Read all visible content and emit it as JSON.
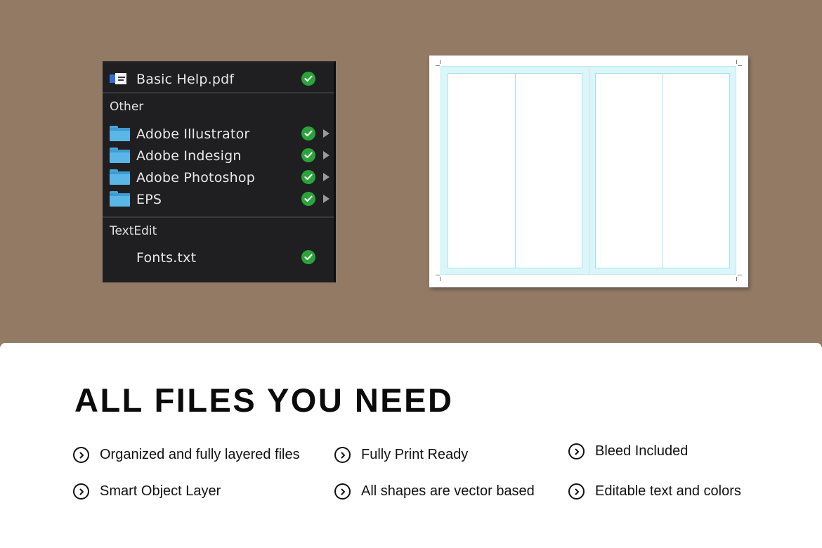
{
  "finder": {
    "top_file": {
      "name": "Basic Help.pdf",
      "icon": "pdf-icon"
    },
    "sections": [
      {
        "label": "Other",
        "items": [
          {
            "name": "Adobe Illustrator",
            "icon": "folder-icon"
          },
          {
            "name": "Adobe Indesign",
            "icon": "folder-icon"
          },
          {
            "name": "Adobe Photoshop",
            "icon": "folder-icon"
          },
          {
            "name": "EPS",
            "icon": "folder-icon"
          }
        ]
      },
      {
        "label": "TextEdit",
        "items": [
          {
            "name": "Fonts.txt",
            "icon": "text-document-icon"
          }
        ]
      }
    ],
    "colors": {
      "panel_bg": "#1f1f21",
      "check": "#2aa43a",
      "folder": "#5ab6e6"
    }
  },
  "card": {
    "headline": "ALL FILES YOU NEED",
    "features": [
      "Organized and fully layered files",
      "Fully Print Ready",
      "Bleed Included",
      "Smart Object Layer",
      "All shapes are vector based",
      "Editable text and colors"
    ]
  },
  "colors": {
    "background": "#937a65",
    "card": "#ffffff",
    "guide": "#9fe5ef",
    "bleed": "#dcf5f9"
  }
}
